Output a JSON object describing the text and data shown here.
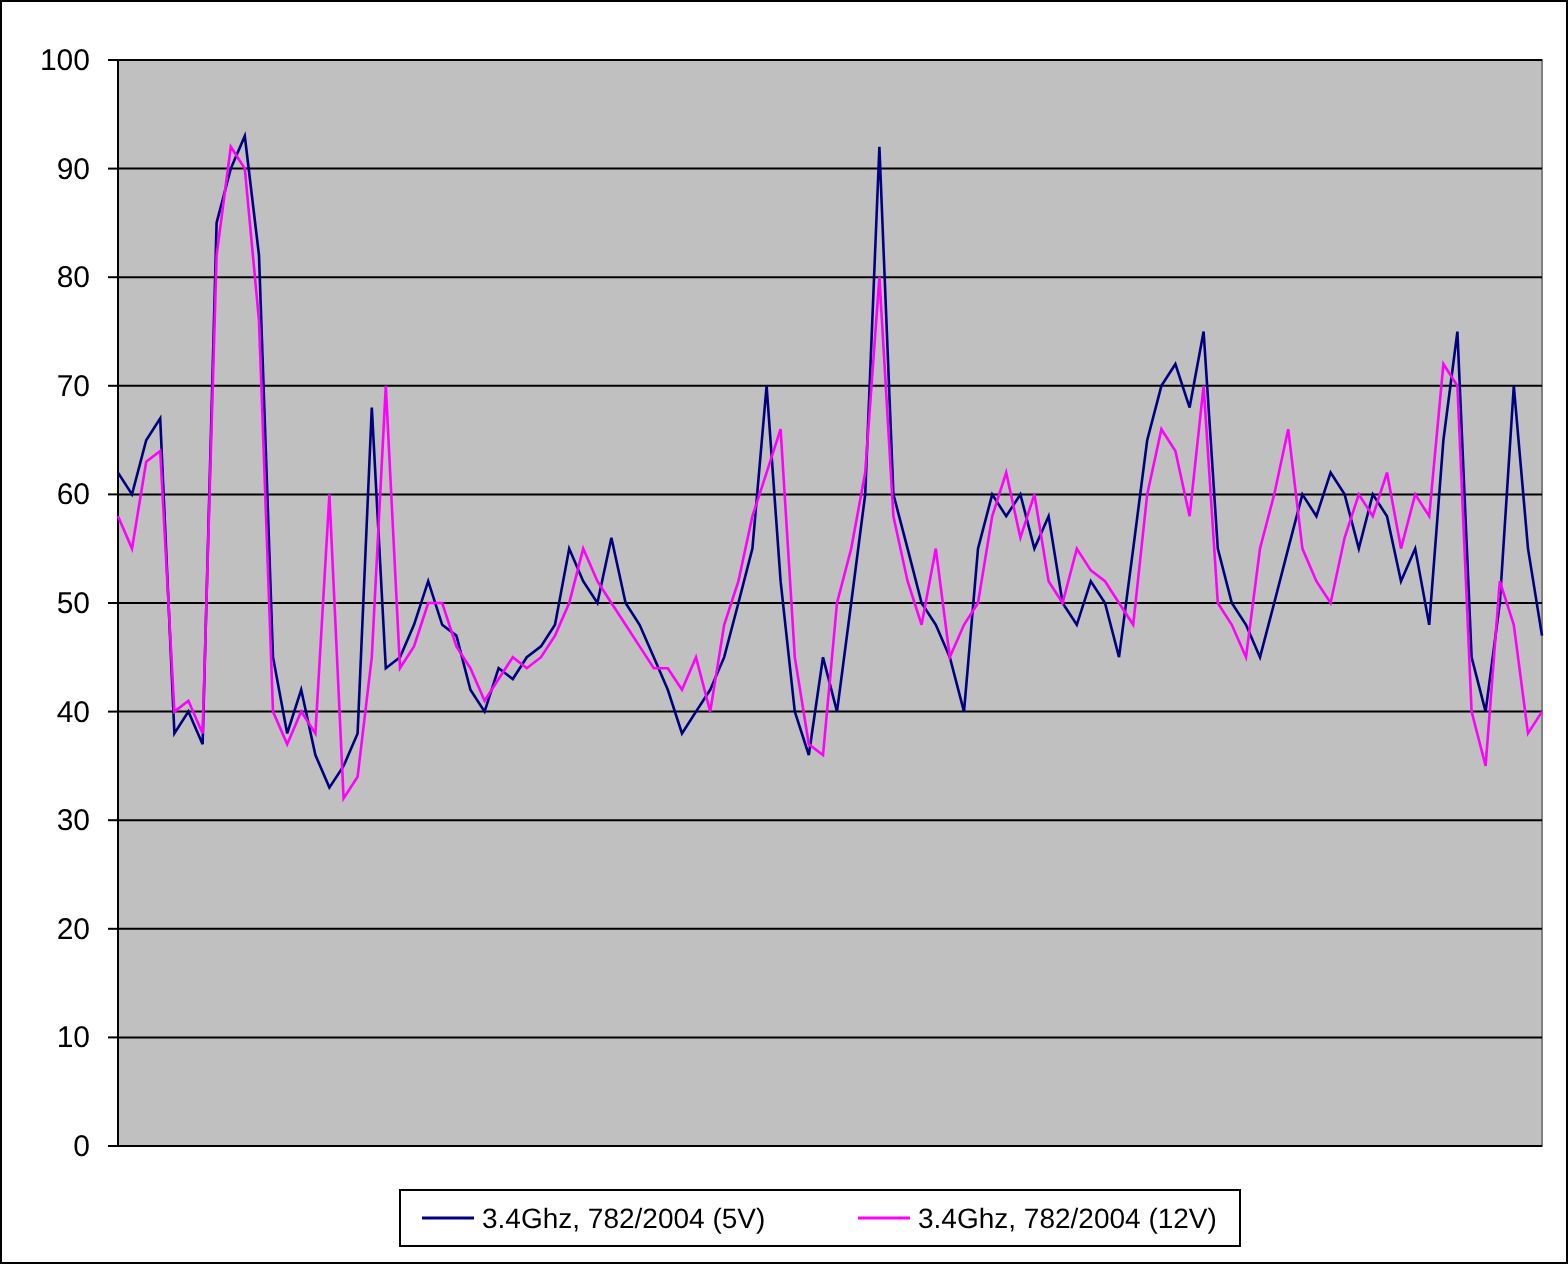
{
  "chart": {
    "chart_data": {
      "type": "line",
      "grid": true,
      "legend": "bottom",
      "ylim": [
        0,
        100
      ],
      "yticks": [
        0,
        10,
        20,
        30,
        40,
        50,
        60,
        70,
        80,
        90,
        100
      ],
      "series": [
        {
          "name": "3.4Ghz, 782/2004 (5V)",
          "color": "#000080",
          "values": [
            62,
            60,
            65,
            67,
            38,
            40,
            37,
            85,
            90,
            93,
            82,
            45,
            38,
            42,
            36,
            33,
            35,
            38,
            68,
            44,
            45,
            48,
            52,
            48,
            47,
            42,
            40,
            44,
            43,
            45,
            46,
            48,
            55,
            52,
            50,
            56,
            50,
            48,
            45,
            42,
            38,
            40,
            42,
            45,
            50,
            55,
            70,
            52,
            40,
            36,
            45,
            40,
            50,
            60,
            92,
            60,
            55,
            50,
            48,
            45,
            40,
            55,
            60,
            58,
            60,
            55,
            58,
            50,
            48,
            52,
            50,
            45,
            55,
            65,
            70,
            72,
            68,
            75,
            55,
            50,
            48,
            45,
            50,
            55,
            60,
            58,
            62,
            60,
            55,
            60,
            58,
            52,
            55,
            48,
            65,
            75,
            45,
            40,
            50,
            70,
            55,
            47
          ]
        },
        {
          "name": "3.4Ghz, 782/2004 (12V)",
          "color": "#ff00ff",
          "values": [
            58,
            55,
            63,
            64,
            40,
            41,
            38,
            82,
            92,
            90,
            76,
            40,
            37,
            40,
            38,
            60,
            32,
            34,
            45,
            70,
            44,
            46,
            50,
            50,
            46,
            44,
            41,
            43,
            45,
            44,
            45,
            47,
            50,
            55,
            52,
            50,
            48,
            46,
            44,
            44,
            42,
            45,
            40,
            48,
            52,
            58,
            62,
            66,
            45,
            37,
            36,
            50,
            55,
            62,
            80,
            58,
            52,
            48,
            55,
            45,
            48,
            50,
            58,
            62,
            56,
            60,
            52,
            50,
            55,
            53,
            52,
            50,
            48,
            60,
            66,
            64,
            58,
            70,
            50,
            48,
            45,
            55,
            60,
            66,
            55,
            52,
            50,
            56,
            60,
            58,
            62,
            55,
            60,
            58,
            72,
            70,
            40,
            35,
            52,
            48,
            38,
            40
          ]
        }
      ]
    }
  }
}
